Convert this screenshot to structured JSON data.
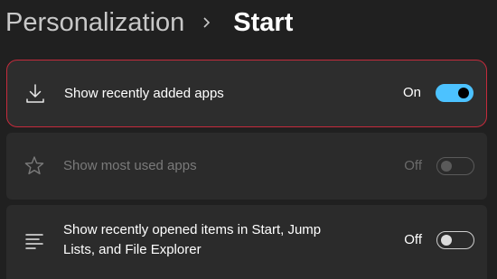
{
  "breadcrumb": {
    "parent": "Personalization",
    "current": "Start"
  },
  "settings": [
    {
      "label": "Show recently added apps",
      "icon": "download-icon",
      "state_text": "On",
      "toggle_on": true,
      "enabled": true,
      "highlighted": true
    },
    {
      "label": "Show most used apps",
      "icon": "star-icon",
      "state_text": "Off",
      "toggle_on": false,
      "enabled": false,
      "highlighted": false
    },
    {
      "label": "Show recently opened items in Start, Jump Lists, and File Explorer",
      "icon": "list-icon",
      "state_text": "Off",
      "toggle_on": false,
      "enabled": true,
      "highlighted": false
    }
  ],
  "colors": {
    "background": "#202020",
    "card": "#2b2b2b",
    "accent": "#4cc2ff",
    "highlight_border": "#c42b3c"
  }
}
